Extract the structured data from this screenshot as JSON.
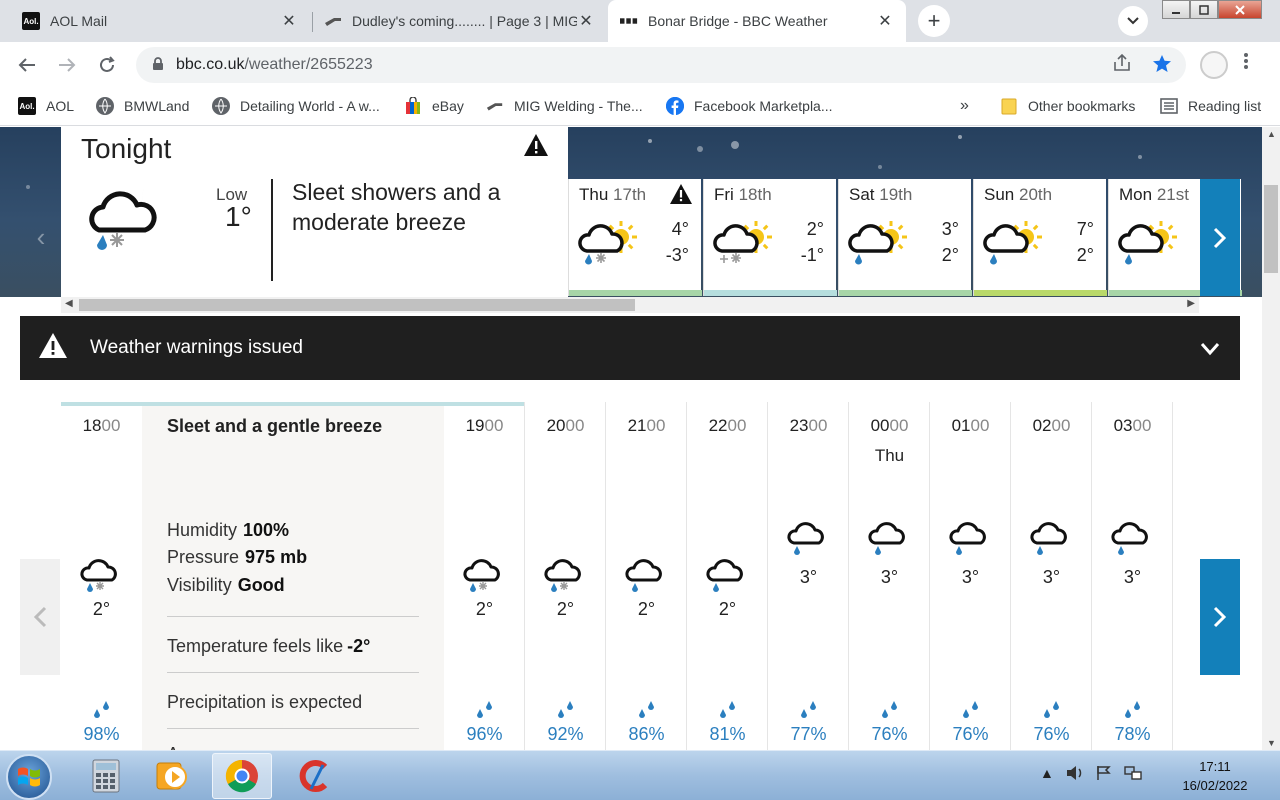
{
  "browser": {
    "tabs": [
      {
        "title": "AOL Mail",
        "favicon": "Aol."
      },
      {
        "title": "Dudley's coming........ | Page 3 | MIG",
        "favicon": ""
      },
      {
        "title": "Bonar Bridge - BBC Weather",
        "favicon": ""
      }
    ],
    "new_tab": "+",
    "close_glyph": "✕",
    "url_host": "bbc.co.uk",
    "url_path": "/weather/2655223",
    "bookmarks": [
      {
        "label": "AOL",
        "icon": "Aol."
      },
      {
        "label": "BMWLand"
      },
      {
        "label": "Detailing World - A w..."
      },
      {
        "label": "eBay"
      },
      {
        "label": "MIG Welding - The..."
      },
      {
        "label": "Facebook Marketpla..."
      }
    ],
    "bookmarks_overflow": "»",
    "other_bookmarks": "Other bookmarks",
    "reading_list": "Reading list"
  },
  "tonight": {
    "title": "Tonight",
    "low_label": "Low",
    "low_value": "1°",
    "description": "Sleet showers and a moderate breeze"
  },
  "days": [
    {
      "day": "Thu",
      "date": "17th",
      "high": "4°",
      "low": "-3°",
      "warning": true,
      "bar": "#a7d5a7",
      "icon": "sleet-sun"
    },
    {
      "day": "Fri",
      "date": "18th",
      "high": "2°",
      "low": "-1°",
      "warning": false,
      "bar": "#b6dede",
      "icon": "snow-sun"
    },
    {
      "day": "Sat",
      "date": "19th",
      "high": "3°",
      "low": "2°",
      "warning": false,
      "bar": "#a7d5a7",
      "icon": "rain-sun"
    },
    {
      "day": "Sun",
      "date": "20th",
      "high": "7°",
      "low": "2°",
      "warning": false,
      "bar": "#b9d96a",
      "icon": "rain-sun"
    },
    {
      "day": "Mon",
      "date": "21st",
      "high": "",
      "low": "",
      "warning": false,
      "bar": "#a7d5a7",
      "icon": "rain-sun"
    }
  ],
  "warning_bar": {
    "text": "Weather warnings issued"
  },
  "selected_hour": {
    "title": "Sleet and a gentle breeze",
    "humidity_label": "Humidity",
    "humidity": "100%",
    "pressure_label": "Pressure",
    "pressure": "975 mb",
    "visibility_label": "Visibility",
    "visibility": "Good",
    "feels_like_label": "Temperature feels like",
    "feels_like": "-2°",
    "precip_text": "Precipitation is expected",
    "cut_text": "A"
  },
  "hours": [
    {
      "h": "18",
      "m": "00",
      "day": "",
      "temp": "2°",
      "pct": "98%",
      "icon": "sleet"
    },
    {
      "h": "19",
      "m": "00",
      "day": "",
      "temp": "2°",
      "pct": "96%",
      "icon": "sleet"
    },
    {
      "h": "20",
      "m": "00",
      "day": "",
      "temp": "2°",
      "pct": "92%",
      "icon": "sleet"
    },
    {
      "h": "21",
      "m": "00",
      "day": "",
      "temp": "2°",
      "pct": "86%",
      "icon": "rain"
    },
    {
      "h": "22",
      "m": "00",
      "day": "",
      "temp": "2°",
      "pct": "81%",
      "icon": "rain-moon"
    },
    {
      "h": "23",
      "m": "00",
      "day": "",
      "temp": "3°",
      "pct": "77%",
      "icon": "rain-moon"
    },
    {
      "h": "00",
      "m": "00",
      "day": "Thu",
      "temp": "3°",
      "pct": "76%",
      "icon": "rain-moon"
    },
    {
      "h": "01",
      "m": "00",
      "day": "",
      "temp": "3°",
      "pct": "76%",
      "icon": "rain-moon"
    },
    {
      "h": "02",
      "m": "00",
      "day": "",
      "temp": "3°",
      "pct": "76%",
      "icon": "rain-moon"
    },
    {
      "h": "03",
      "m": "00",
      "day": "",
      "temp": "3°",
      "pct": "78%",
      "icon": "rain-moon"
    }
  ],
  "taskbar": {
    "time": "17:11",
    "date": "16/02/2022"
  },
  "colors": {
    "bbc_blue": "#1380ba",
    "precip_blue": "#2b7fbf",
    "warning_bar": "#1f1f1f"
  }
}
